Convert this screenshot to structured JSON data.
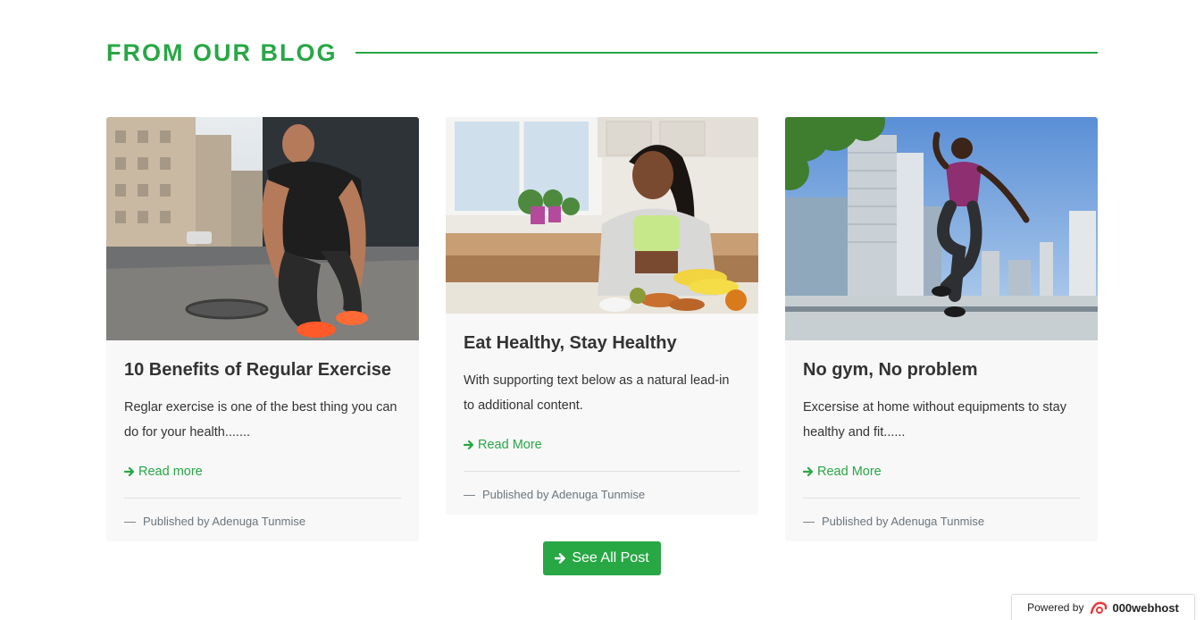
{
  "section": {
    "title": "FROM OUR BLOG"
  },
  "posts": [
    {
      "title": "10 Benefits of Regular Exercise",
      "excerpt": "Reglar exercise is one of the best thing you can do for your health.......",
      "link_label": "Read more",
      "author_line": "Published by Adenuga Tunmise",
      "image": "man tying running shoe on city street"
    },
    {
      "title": "Eat Healthy, Stay Healthy",
      "excerpt": "With supporting text below as a natural lead-in to additional content.",
      "link_label": "Read More",
      "author_line": "Published by Adenuga Tunmise",
      "image": "woman preparing vegetables in kitchen"
    },
    {
      "title": "No gym, No problem",
      "excerpt": "Excersise at home without equipments to stay healthy and fit......",
      "link_label": "Read More",
      "author_line": "Published by Adenuga Tunmise",
      "image": "man jumping in front of city skyline"
    }
  ],
  "see_all_button": {
    "label": "See All Post"
  },
  "footer_badge": {
    "prefix": "Powered by",
    "brand": "000webhost"
  },
  "colors": {
    "accent": "#28a745",
    "card_bg": "#f8f8f8",
    "muted": "#6c757d"
  }
}
